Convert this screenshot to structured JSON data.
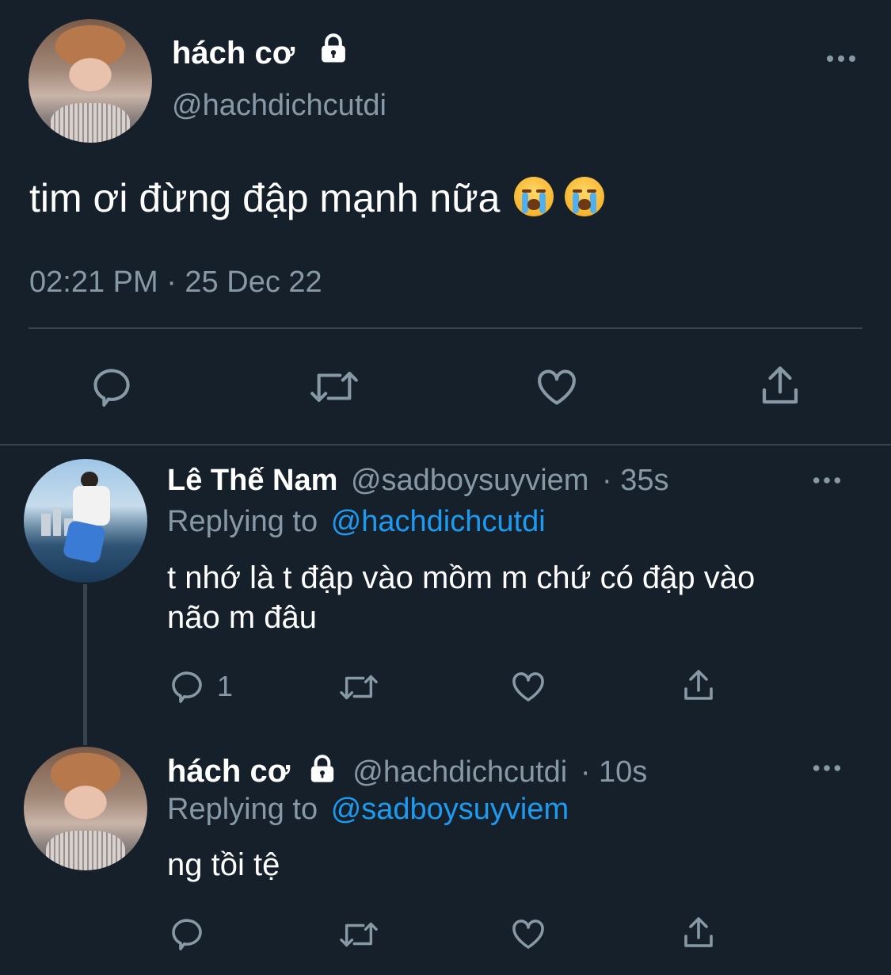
{
  "main_tweet": {
    "display_name": "hách cơ",
    "handle": "@hachdichcutdi",
    "text": "tim ơi đừng đập mạnh nữa",
    "emojis": [
      "loudly-crying-face",
      "loudly-crying-face"
    ],
    "timestamp": "02:21 PM · 25 Dec 22"
  },
  "replies": [
    {
      "display_name": "Lê Thế Nam",
      "handle": "@sadboysuyviem",
      "time": "· 35s",
      "replying_label": "Replying to",
      "replying_handle": "@hachdichcutdi",
      "text_line1": "t nhớ là t đập vào mồm m chứ có đập vào",
      "text_line2": "não m đâu",
      "reply_count": "1"
    },
    {
      "display_name": "hách cơ",
      "handle": "@hachdichcutdi",
      "time": "· 10s",
      "replying_label": "Replying to",
      "replying_handle": "@sadboysuyviem",
      "text": "ng tồi tệ"
    }
  ],
  "colors": {
    "background": "#15202b",
    "muted": "#8899a6",
    "link": "#1d9bf0",
    "divider": "#38444d"
  }
}
